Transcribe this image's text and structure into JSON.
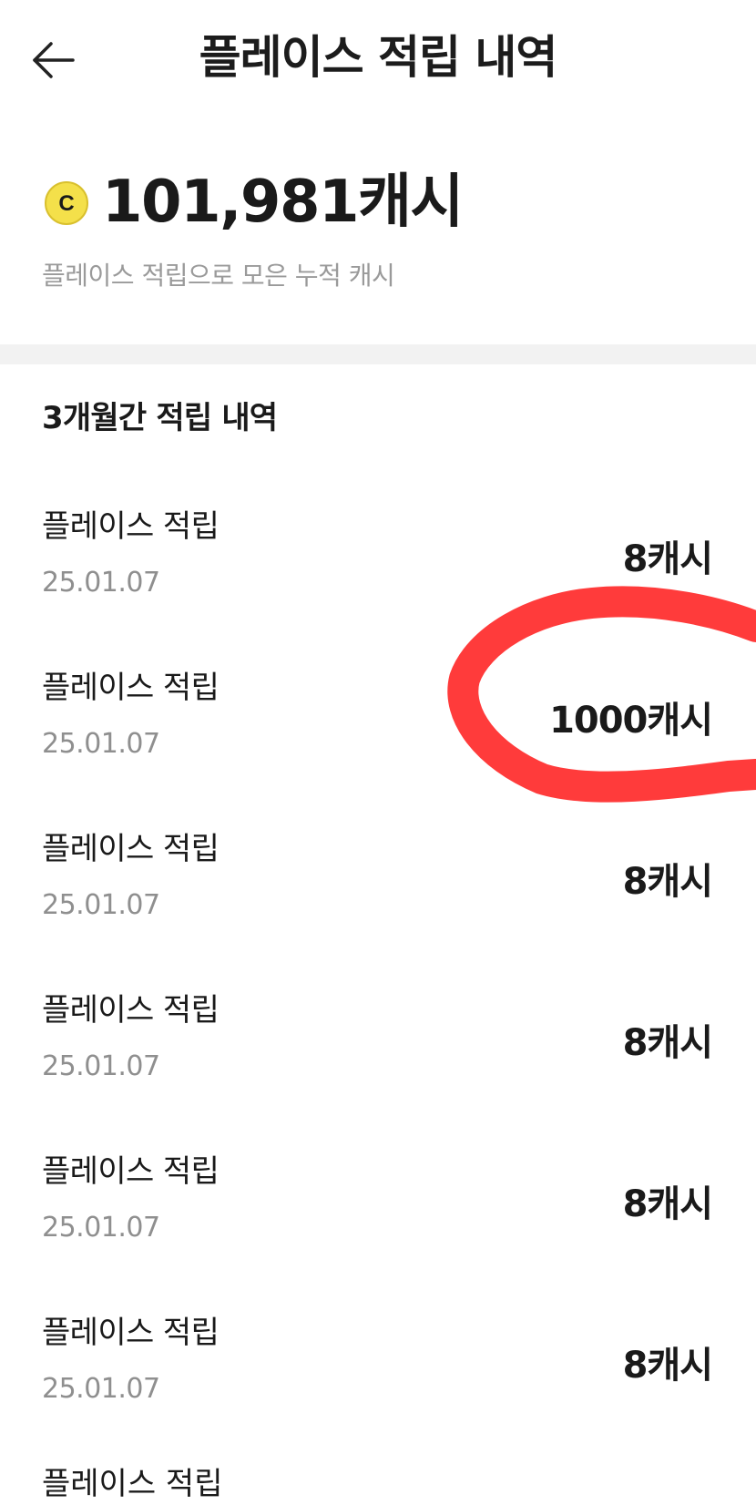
{
  "header": {
    "title": "플레이스 적립 내역",
    "back_icon": "arrow-left-icon"
  },
  "summary": {
    "coin_icon": "cash-coin-icon",
    "coin_letter": "C",
    "total": "101,981캐시",
    "description": "플레이스 적립으로 모은 누적 캐시"
  },
  "history": {
    "title": "3개월간 적립 내역",
    "items": [
      {
        "label": "플레이스 적립",
        "date": "25.01.07",
        "amount": "8캐시"
      },
      {
        "label": "플레이스 적립",
        "date": "25.01.07",
        "amount": "1000캐시"
      },
      {
        "label": "플레이스 적립",
        "date": "25.01.07",
        "amount": "8캐시"
      },
      {
        "label": "플레이스 적립",
        "date": "25.01.07",
        "amount": "8캐시"
      },
      {
        "label": "플레이스 적립",
        "date": "25.01.07",
        "amount": "8캐시"
      },
      {
        "label": "플레이스 적립",
        "date": "25.01.07",
        "amount": "8캐시"
      }
    ],
    "partial_label": "플레이스 적립"
  },
  "colors": {
    "coin": "#f4e04a",
    "annotation": "#ff3b3b",
    "divider": "#f2f2f2"
  }
}
